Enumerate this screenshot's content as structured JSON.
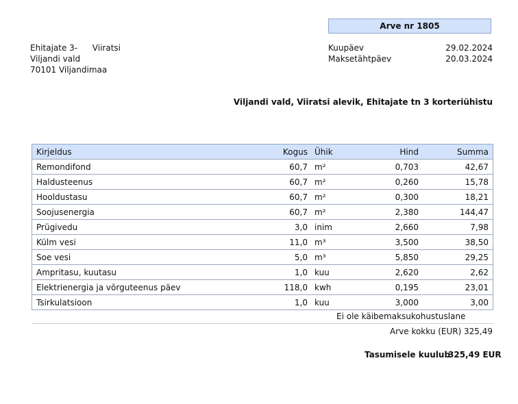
{
  "invoice": {
    "title": "Arve nr 1805"
  },
  "address": {
    "line1a": "Ehitajate 3-",
    "line1b": "Viiratsi",
    "line2": "Viljandi vald",
    "line3": "70101 Viljandimaa"
  },
  "meta": {
    "invoice_date_label": "Kuupäev",
    "invoice_date": "29.02.2024",
    "due_date_label": "Maksetähtpäev",
    "due_date": "20.03.2024"
  },
  "association": "Viljandi vald, Viiratsi alevik, Ehitajate tn 3 korteriühistu",
  "table": {
    "headers": {
      "desc": "Kirjeldus",
      "qty": "Kogus",
      "unit": "Ühik",
      "price": "Hind",
      "sum": "Summa"
    },
    "rows": [
      {
        "desc": "Remondifond",
        "qty": "60,7",
        "unit": "m²",
        "price": "0,703",
        "sum": "42,67"
      },
      {
        "desc": "Haldusteenus",
        "qty": "60,7",
        "unit": "m²",
        "price": "0,260",
        "sum": "15,78"
      },
      {
        "desc": "Hooldustasu",
        "qty": "60,7",
        "unit": "m²",
        "price": "0,300",
        "sum": "18,21"
      },
      {
        "desc": "Soojusenergia",
        "qty": "60,7",
        "unit": "m²",
        "price": "2,380",
        "sum": "144,47"
      },
      {
        "desc": "Prügivedu",
        "qty": "3,0",
        "unit": "inim",
        "price": "2,660",
        "sum": "7,98"
      },
      {
        "desc": "Külm vesi",
        "qty": "11,0",
        "unit": "m³",
        "price": "3,500",
        "sum": "38,50"
      },
      {
        "desc": "Soe vesi",
        "qty": "5,0",
        "unit": "m³",
        "price": "5,850",
        "sum": "29,25"
      },
      {
        "desc": "Ampritasu, kuutasu",
        "qty": "1,0",
        "unit": "kuu",
        "price": "2,620",
        "sum": "2,62"
      },
      {
        "desc": "Elektrienergia ja võrguteenus päev",
        "qty": "118,0",
        "unit": "kwh",
        "price": "0,195",
        "sum": "23,01"
      },
      {
        "desc": "Tsirkulatsioon",
        "qty": "1,0",
        "unit": "kuu",
        "price": "3,000",
        "sum": "3,00"
      }
    ]
  },
  "vat_note": "Ei ole käibemaksukohustuslane",
  "totals": {
    "total_label": "Arve kokku  (EUR)",
    "total_value": "325,49",
    "due_label": "Tasumisele kuulub",
    "due_value": "325,49 EUR"
  }
}
